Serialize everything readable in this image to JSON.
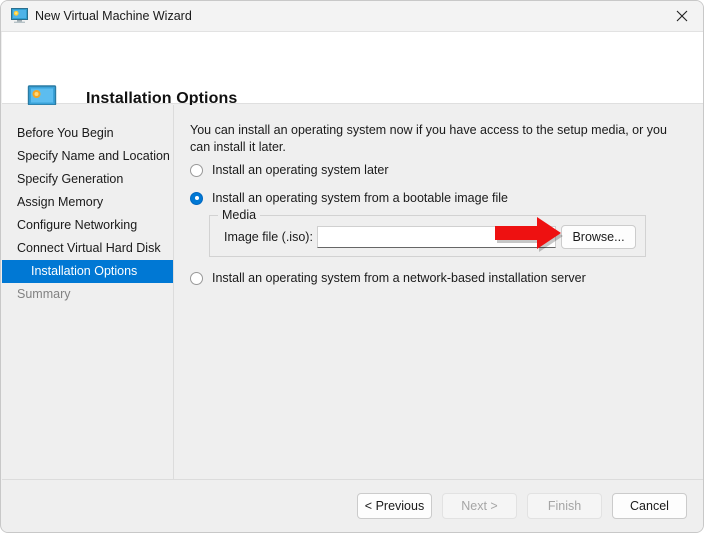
{
  "window": {
    "title": "New Virtual Machine Wizard",
    "title_icon": "vm-monitor-icon",
    "close_icon": "close-icon"
  },
  "header": {
    "title": "Installation Options",
    "icon": "vm-monitor-icon"
  },
  "sidebar": {
    "items": [
      {
        "label": "Before You Begin",
        "state": "normal"
      },
      {
        "label": "Specify Name and Location",
        "state": "normal"
      },
      {
        "label": "Specify Generation",
        "state": "normal"
      },
      {
        "label": "Assign Memory",
        "state": "normal"
      },
      {
        "label": "Configure Networking",
        "state": "normal"
      },
      {
        "label": "Connect Virtual Hard Disk",
        "state": "normal"
      },
      {
        "label": "Installation Options",
        "state": "selected"
      },
      {
        "label": "Summary",
        "state": "disabled"
      }
    ],
    "selected_bg": "#0078d4"
  },
  "main": {
    "intro": "You can install an operating system now if you have access to the setup media, or you can install it later.",
    "options": [
      {
        "label": "Install an operating system later",
        "checked": false
      },
      {
        "label": "Install an operating system from a bootable image file",
        "checked": true
      },
      {
        "label": "Install an operating system from a network-based installation server",
        "checked": false
      }
    ],
    "media_group": {
      "legend": "Media",
      "field_label": "Image file (.iso):",
      "field_value": "",
      "field_placeholder": "",
      "browse_label": "Browse..."
    }
  },
  "annotation": {
    "type": "arrow",
    "color": "#ee1111",
    "points_to": "browse-button"
  },
  "footer": {
    "buttons": [
      {
        "label": "< Previous",
        "enabled": true
      },
      {
        "label": "Next >",
        "enabled": false
      },
      {
        "label": "Finish",
        "enabled": false
      },
      {
        "label": "Cancel",
        "enabled": true
      }
    ]
  }
}
